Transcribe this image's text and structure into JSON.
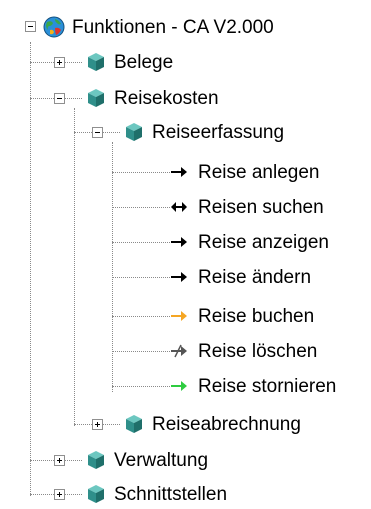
{
  "tree": {
    "root": {
      "label": "Funktionen - CA V2.000",
      "icon": "globe-icon",
      "expanded": true
    },
    "belege": {
      "label": "Belege",
      "icon": "cube-icon",
      "expanded": false
    },
    "reisekosten": {
      "label": "Reisekosten",
      "icon": "cube-icon",
      "expanded": true
    },
    "reiseerfassung": {
      "label": "Reiseerfassung",
      "icon": "cube-icon",
      "expanded": true
    },
    "actions": [
      {
        "label": "Reise anlegen",
        "icon": "arrow-right-icon",
        "color": "#000000"
      },
      {
        "label": "Reisen suchen",
        "icon": "arrow-double-icon",
        "color": "#000000"
      },
      {
        "label": "Reise anzeigen",
        "icon": "arrow-right-icon",
        "color": "#000000"
      },
      {
        "label": "Reise ändern",
        "icon": "arrow-right-icon",
        "color": "#000000"
      },
      {
        "label": "Reise buchen",
        "icon": "arrow-right-icon",
        "color": "#f5a623"
      },
      {
        "label": "Reise löschen",
        "icon": "arrow-crossed-icon",
        "color": "#555555"
      },
      {
        "label": "Reise stornieren",
        "icon": "arrow-right-icon",
        "color": "#2ecc40"
      }
    ],
    "reiseabrechnung": {
      "label": "Reiseabrechnung",
      "icon": "cube-icon",
      "expanded": false
    },
    "verwaltung": {
      "label": "Verwaltung",
      "icon": "cube-icon",
      "expanded": false
    },
    "schnittstellen": {
      "label": "Schnittstellen",
      "icon": "cube-icon",
      "expanded": false
    }
  },
  "colors": {
    "cube_front": "#2f8f8a",
    "cube_top": "#6cc7c0",
    "cube_side": "#1f6f6a",
    "connector": "#8a8a8a"
  }
}
